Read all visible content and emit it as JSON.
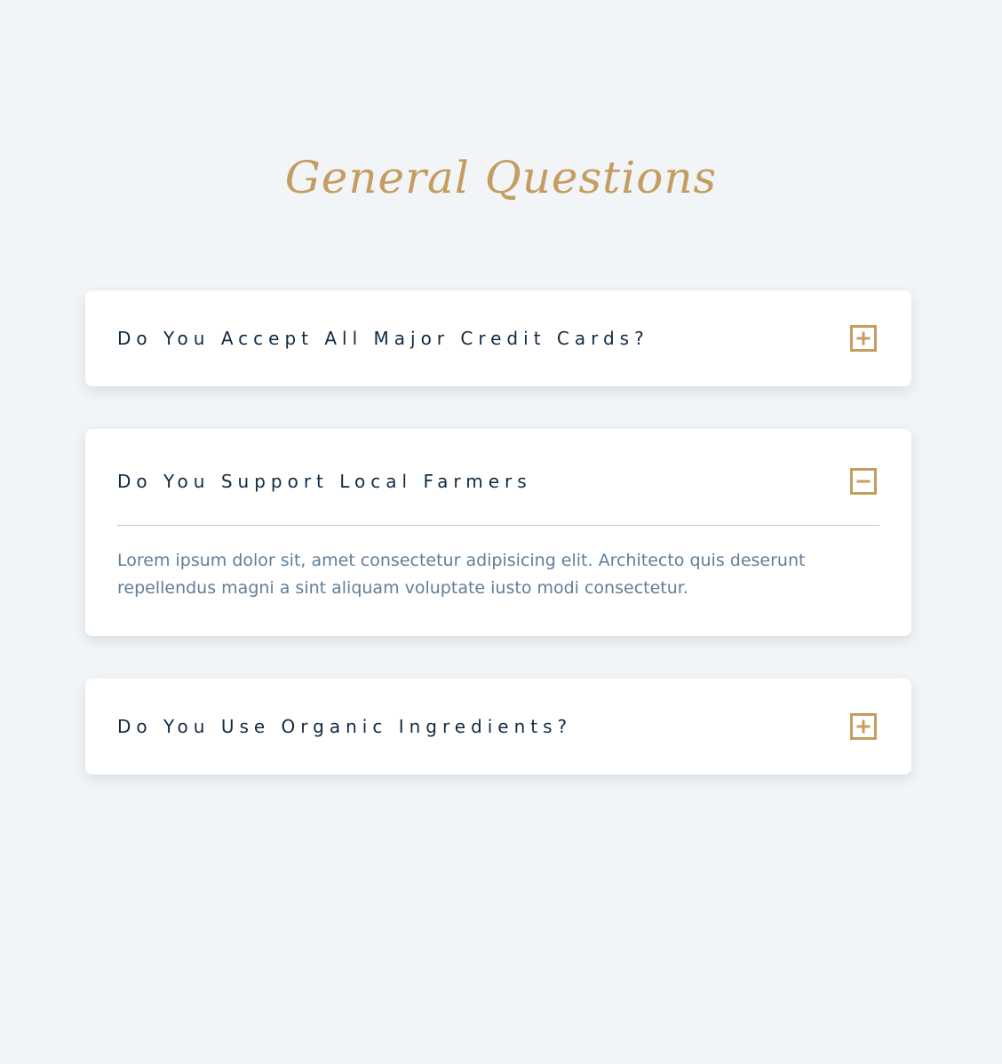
{
  "page": {
    "title": "General Questions"
  },
  "faq": [
    {
      "question": "Do You Accept All Major Credit Cards?",
      "expanded": false,
      "toggle_icon": "plus-square-icon"
    },
    {
      "question": "Do You Support Local Farmers",
      "expanded": true,
      "toggle_icon": "minus-square-icon",
      "answer": "Lorem ipsum dolor sit, amet consectetur adipisicing elit. Architecto quis deserunt repellendus magni a sint aliquam voluptate iusto modi consectetur."
    },
    {
      "question": "Do You Use Organic Ingredients?",
      "expanded": false,
      "toggle_icon": "plus-square-icon"
    }
  ],
  "colors": {
    "background": "#f1f5f8",
    "accent": "#c59d5f",
    "question_text": "#102a42",
    "answer_text": "#617d98",
    "card": "#ffffff"
  }
}
